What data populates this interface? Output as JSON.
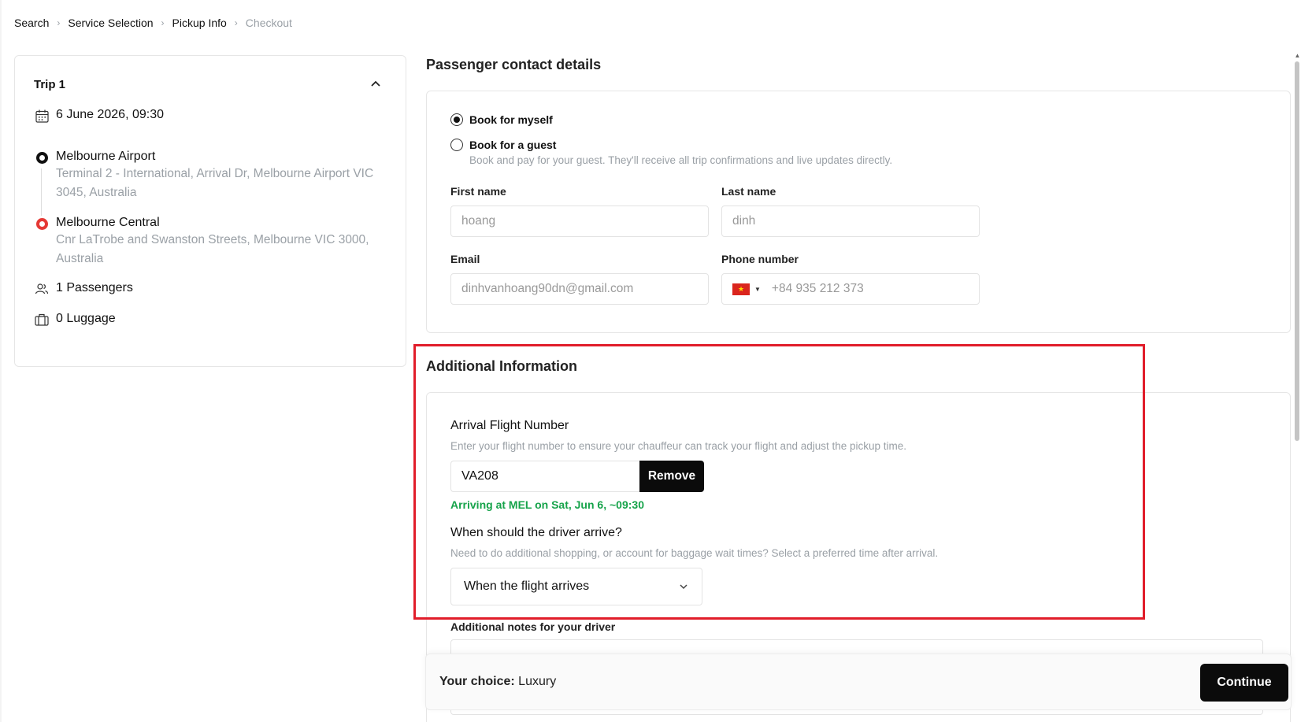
{
  "breadcrumb": {
    "items": [
      "Search",
      "Service Selection",
      "Pickup Info",
      "Checkout"
    ]
  },
  "trip": {
    "title": "Trip 1",
    "datetime": "6 June 2026, 09:30",
    "pickup": {
      "name": "Melbourne Airport",
      "address_line1": "Terminal 2 - International, Arrival Dr, Melbourne Airport VIC",
      "address_line2": "3045, Australia"
    },
    "dropoff": {
      "name": "Melbourne Central",
      "address_line1": "Cnr LaTrobe and Swanston Streets, Melbourne VIC 3000,",
      "address_line2": "Australia"
    },
    "passengers": "1 Passengers",
    "luggage": "0 Luggage"
  },
  "contact": {
    "section_title": "Passenger contact details",
    "book_myself": "Book for myself",
    "book_guest": "Book for a guest",
    "book_guest_desc": "Book and pay for your guest. They'll receive all trip confirmations and live updates directly.",
    "first_name_label": "First name",
    "first_name_value": "hoang",
    "last_name_label": "Last name",
    "last_name_value": "dinh",
    "email_label": "Email",
    "email_value": "dinhvanhoang90dn@gmail.com",
    "phone_label": "Phone number",
    "phone_value": "+84 935 212 373"
  },
  "additional": {
    "section_title": "Additional Information",
    "flight_label": "Arrival Flight Number",
    "flight_desc": "Enter your flight number to ensure your chauffeur can track your flight and adjust the pickup time.",
    "flight_value": "VA208",
    "remove_label": "Remove",
    "arrival_status": "Arriving at MEL on Sat, Jun 6, ~09:30",
    "driver_label": "When should the driver arrive?",
    "driver_desc": "Need to do additional shopping, or account for baggage wait times? Select a preferred time after arrival.",
    "driver_selected": "When the flight arrives",
    "notes_label": "Additional notes for your driver"
  },
  "footer": {
    "choice_prefix": "Your choice:",
    "choice_value": "Luxury",
    "continue_label": "Continue"
  },
  "colors": {
    "highlight": "#e11d2a",
    "success": "#16a34a",
    "dropoff_marker": "#e53935",
    "primary_button": "#0b0b0b"
  }
}
